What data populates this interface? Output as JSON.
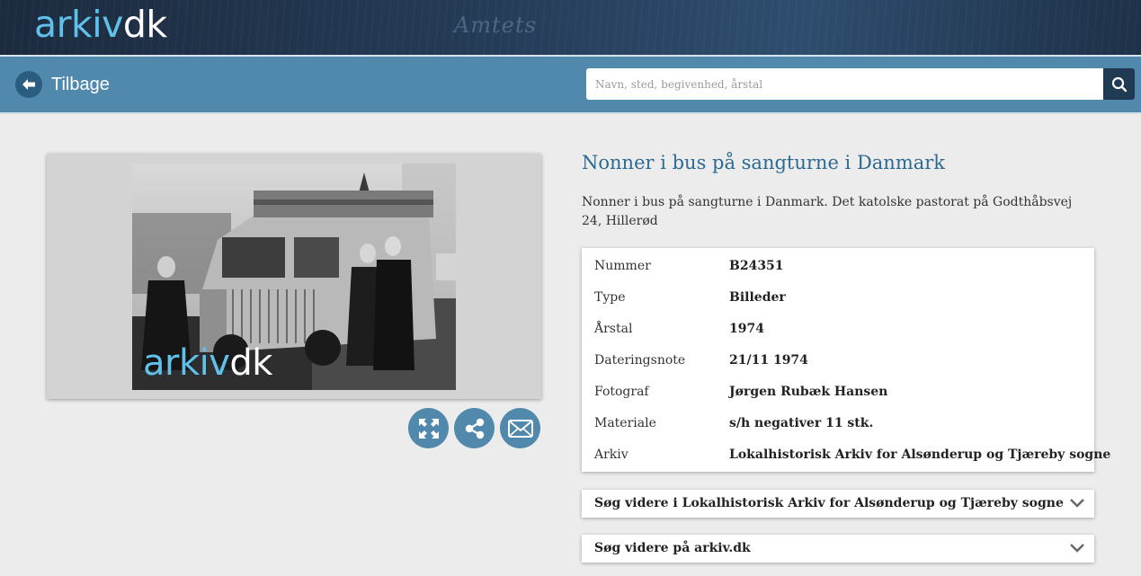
{
  "header": {
    "logo_part1": "arkiv",
    "logo_part2": "dk",
    "background_script_text": "Amtets"
  },
  "nav": {
    "back_label": "Tilbage",
    "search_placeholder": "Navn, sted, begivenhed, årstal",
    "search_icon": "search-icon"
  },
  "image_viewer": {
    "watermark_part1": "arkiv",
    "watermark_part2": "dk",
    "actions": [
      {
        "name": "fullscreen-button",
        "icon": "expand-icon"
      },
      {
        "name": "share-button",
        "icon": "share-icon"
      },
      {
        "name": "email-button",
        "icon": "envelope-icon"
      }
    ]
  },
  "record": {
    "title": "Nonner i bus på sangturne i Danmark",
    "description": "Nonner i bus på sangturne i Danmark. Det katolske pastorat på Godthåbsvej 24, Hillerød",
    "fields": [
      {
        "label": "Nummer",
        "value": "B24351"
      },
      {
        "label": "Type",
        "value": "Billeder"
      },
      {
        "label": "Årstal",
        "value": "1974"
      },
      {
        "label": "Dateringsnote",
        "value": "21/11 1974"
      },
      {
        "label": "Fotograf",
        "value": "Jørgen Rubæk Hansen"
      },
      {
        "label": "Materiale",
        "value": "s/h negativer 11 stk."
      },
      {
        "label": "Arkiv",
        "value": "Lokalhistorisk Arkiv for Alsønderup og Tjæreby sogne"
      }
    ]
  },
  "accordions": [
    {
      "label": "Søg videre i Lokalhistorisk Arkiv for Alsønderup og Tjæreby sogne"
    },
    {
      "label": "Søg videre på arkiv.dk"
    }
  ],
  "colors": {
    "nav_blue": "#5089ac",
    "title_blue": "#2d6a93",
    "logo_cyan": "#5fc1ea",
    "search_button": "#1f3a52"
  }
}
